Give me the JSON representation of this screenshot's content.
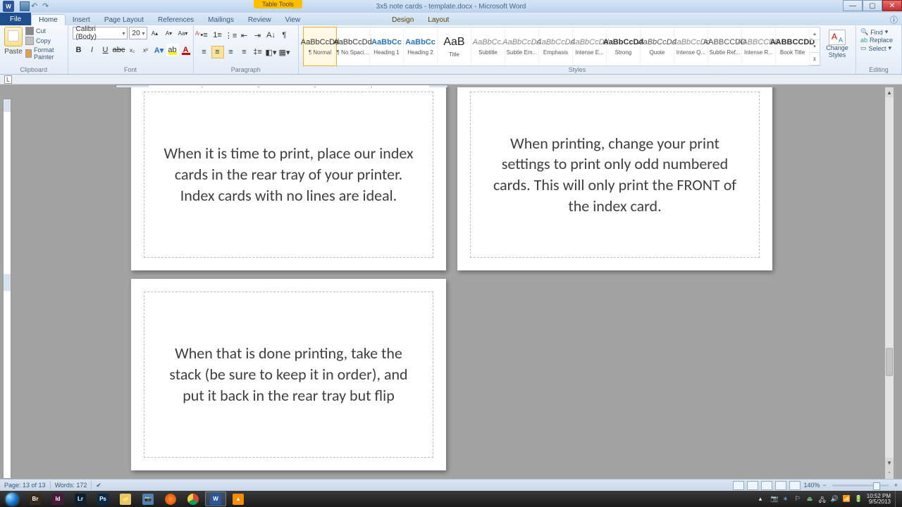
{
  "title": {
    "context_tab": "Table Tools",
    "doc": "3x5 note cards - template.docx - Microsoft Word"
  },
  "tabs": {
    "file": "File",
    "list": [
      "Home",
      "Insert",
      "Page Layout",
      "References",
      "Mailings",
      "Review",
      "View"
    ],
    "tt": [
      "Design",
      "Layout"
    ],
    "active": "Home"
  },
  "clipboard": {
    "paste": "Paste",
    "cut": "Cut",
    "copy": "Copy",
    "fmt": "Format Painter",
    "label": "Clipboard"
  },
  "font": {
    "name": "Calibri (Body)",
    "size": "20",
    "label": "Font"
  },
  "paragraph": {
    "label": "Paragraph"
  },
  "styles": {
    "label": "Styles",
    "change": "Change Styles",
    "items": [
      {
        "id": "normal",
        "preview": "AaBbCcDd",
        "name": "¶ Normal"
      },
      {
        "id": "nospacing",
        "preview": "AaBbCcDd",
        "name": "¶ No Spaci..."
      },
      {
        "id": "heading1",
        "preview": "AaBbCc",
        "name": "Heading 1"
      },
      {
        "id": "heading2",
        "preview": "AaBbCc",
        "name": "Heading 2"
      },
      {
        "id": "title",
        "preview": "AaB",
        "name": "Title"
      },
      {
        "id": "subtitle",
        "preview": "AaBbCc.",
        "name": "Subtitle"
      },
      {
        "id": "subtle-emph",
        "preview": "AaBbCcDd",
        "name": "Subtle Em..."
      },
      {
        "id": "emphasis",
        "preview": "AaBbCcDd",
        "name": "Emphasis"
      },
      {
        "id": "intense-emph",
        "preview": "AaBbCcDd",
        "name": "Intense E..."
      },
      {
        "id": "strong",
        "preview": "AaBbCcDd",
        "name": "Strong"
      },
      {
        "id": "quote",
        "preview": "AaBbCcDd",
        "name": "Quote"
      },
      {
        "id": "intense-quote",
        "preview": "AaBbCcDd",
        "name": "Intense Q..."
      },
      {
        "id": "subtle-ref",
        "preview": "AABBCCDD",
        "name": "Subtle Ref..."
      },
      {
        "id": "intense-ref",
        "preview": "AABBCCDD",
        "name": "Intense R..."
      },
      {
        "id": "book-title",
        "preview": "AABBCCDD",
        "name": "Book Title"
      }
    ]
  },
  "editing": {
    "find": "Find",
    "replace": "Replace",
    "select": "Select",
    "label": "Editing"
  },
  "cards": [
    "When it is time to print, place our index cards in the rear tray of your printer.  Index cards with no lines are ideal.",
    "When printing, change your print settings to print only odd numbered cards.  This will only print the FRONT of the index card.",
    "When that is done printing, take the stack (be sure to keep it in order), and put it back in the rear tray but flip"
  ],
  "status": {
    "page": "Page: 13 of 13",
    "words": "Words: 172",
    "zoom": "140%"
  },
  "tray": {
    "time": "10:52 PM",
    "date": "9/5/2013"
  }
}
